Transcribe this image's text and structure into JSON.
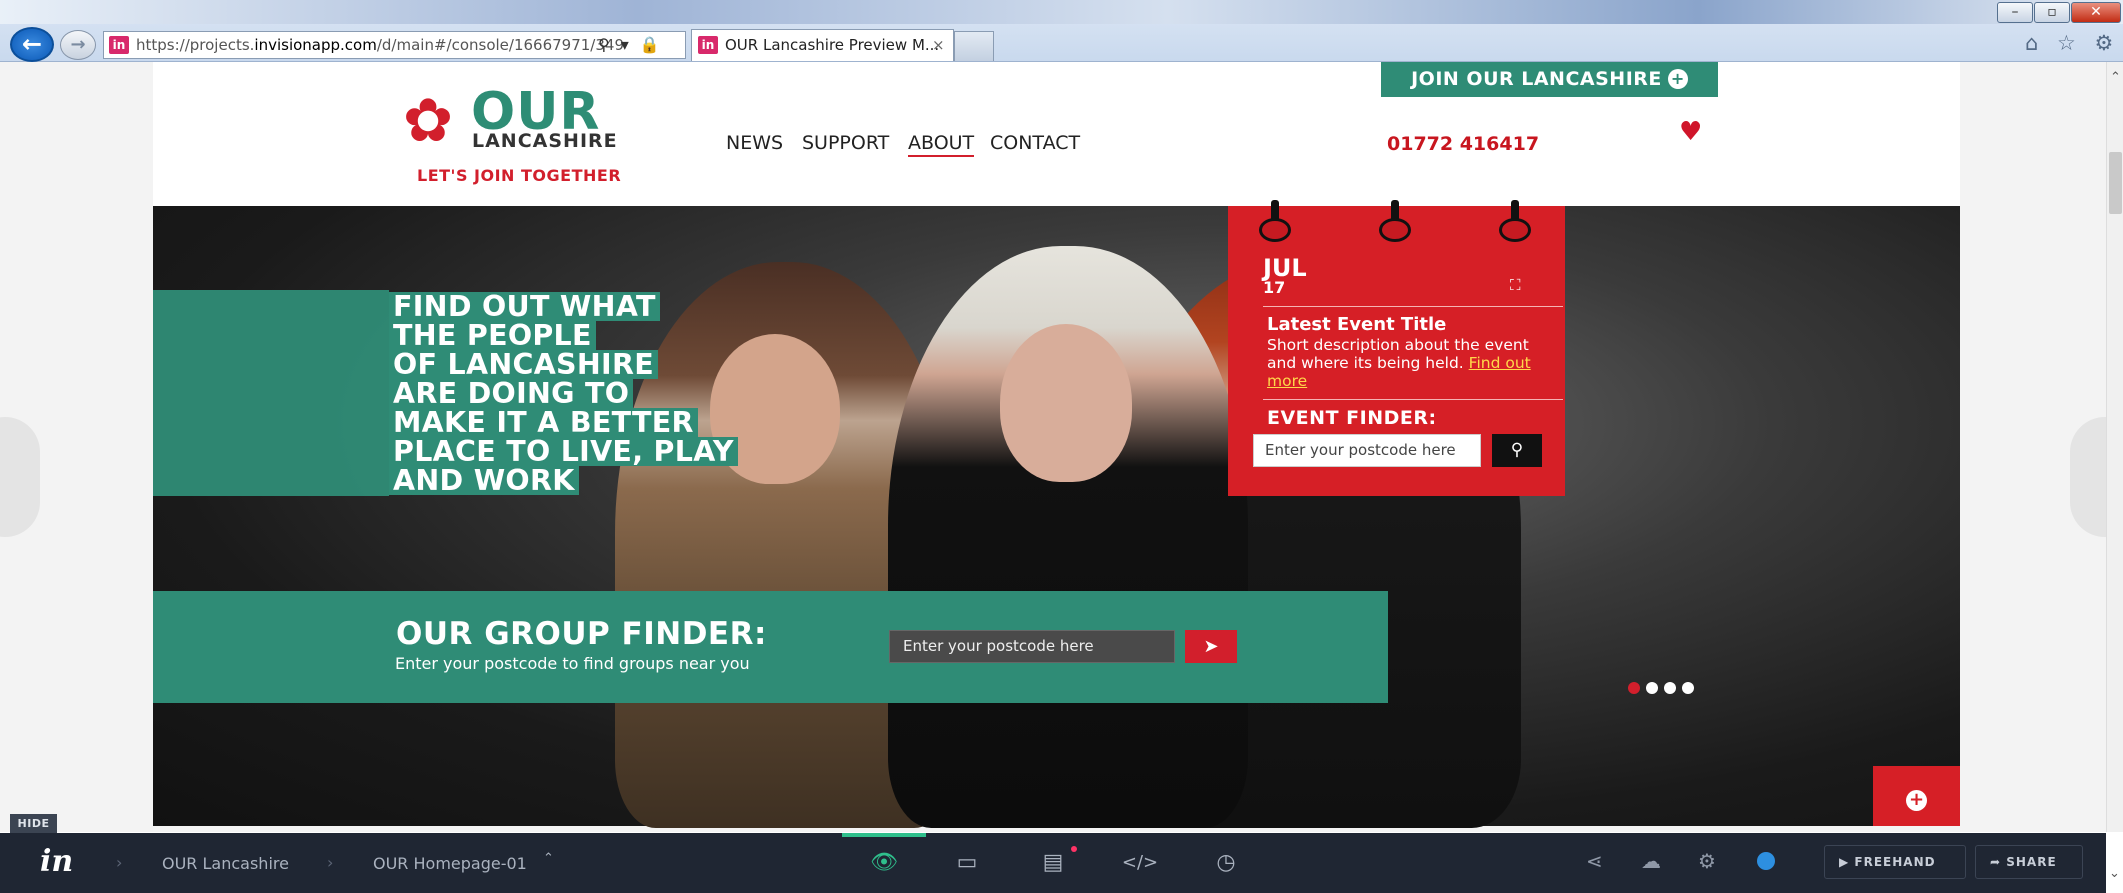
{
  "browser": {
    "address": "https://projects.invisionapp.com/d/main#/console/16667971/349",
    "address_host": "invisionapp.com",
    "address_scheme_prefix": "https://projects.",
    "address_path": "/d/main#/console/16667971/349",
    "favicon_label": "in",
    "tab_title": "OUR Lancashire Preview M...",
    "tab_close": "×",
    "address_icons": "⚲ ▾ 🔒 ↻",
    "back_glyph": "←",
    "forward_glyph": "→",
    "tools_icons": "⌂ ☆ ⚙",
    "win_min": "–",
    "win_max": "▫",
    "win_close": "✕"
  },
  "site": {
    "join_label": "JOIN OUR LANCASHIRE",
    "join_plus": "+",
    "logo_mark": "✿",
    "logo_our": "OUR",
    "logo_lancashire": "LANCASHIRE",
    "logo_tagline": "LET'S JOIN TOGETHER",
    "nav": [
      "NEWS",
      "SUPPORT",
      "ABOUT",
      "CONTACT"
    ],
    "nav_active": "ABOUT",
    "phone": "01772 416417",
    "heart": "♥"
  },
  "hero": {
    "headline_lines": [
      "FIND OUT WHAT",
      "THE PEOPLE",
      "OF LANCASHIRE",
      "ARE DOING TO",
      "MAKE IT A BETTER",
      "PLACE TO LIVE, PLAY",
      "AND WORK"
    ],
    "group_finder_title": "OUR GROUP FINDER:",
    "group_finder_sub": "Enter your postcode to find groups near you",
    "group_finder_placeholder": "Enter your postcode here",
    "group_go_icon": "➤",
    "slider_dots": 4,
    "slider_active": 1,
    "fab_icon": "+"
  },
  "event": {
    "month": "JUL",
    "day": "17",
    "expand_icon": "⛶",
    "title": "Latest Event Title",
    "description": "Short description about the event and where its being held.",
    "find_more": "Find out more",
    "finder_label": "EVENT FINDER:",
    "finder_placeholder": "Enter your postcode here",
    "finder_icon": "⚲"
  },
  "invision": {
    "hide": "HIDE",
    "logo": "in",
    "crumbs": [
      "OUR Lancashire",
      "OUR Homepage-01"
    ],
    "crumb_sep": "›",
    "crumb_caret": "⌃",
    "tool_icons": [
      "preview-icon",
      "build-icon",
      "comment-icon",
      "inspect-icon",
      "history-icon"
    ],
    "tool_glyphs": [
      "👁",
      "▭",
      "▤",
      "</>",
      "◷"
    ],
    "right_glyphs": [
      "⋖",
      "☁",
      "⚙"
    ],
    "freehand": "FREEHAND",
    "share": "SHARE",
    "freehand_icon": "▶",
    "share_icon": "➦"
  },
  "colors": {
    "brand_green": "#2f8c76",
    "brand_red": "#d21f2c",
    "invision_bar": "#1f2633"
  }
}
